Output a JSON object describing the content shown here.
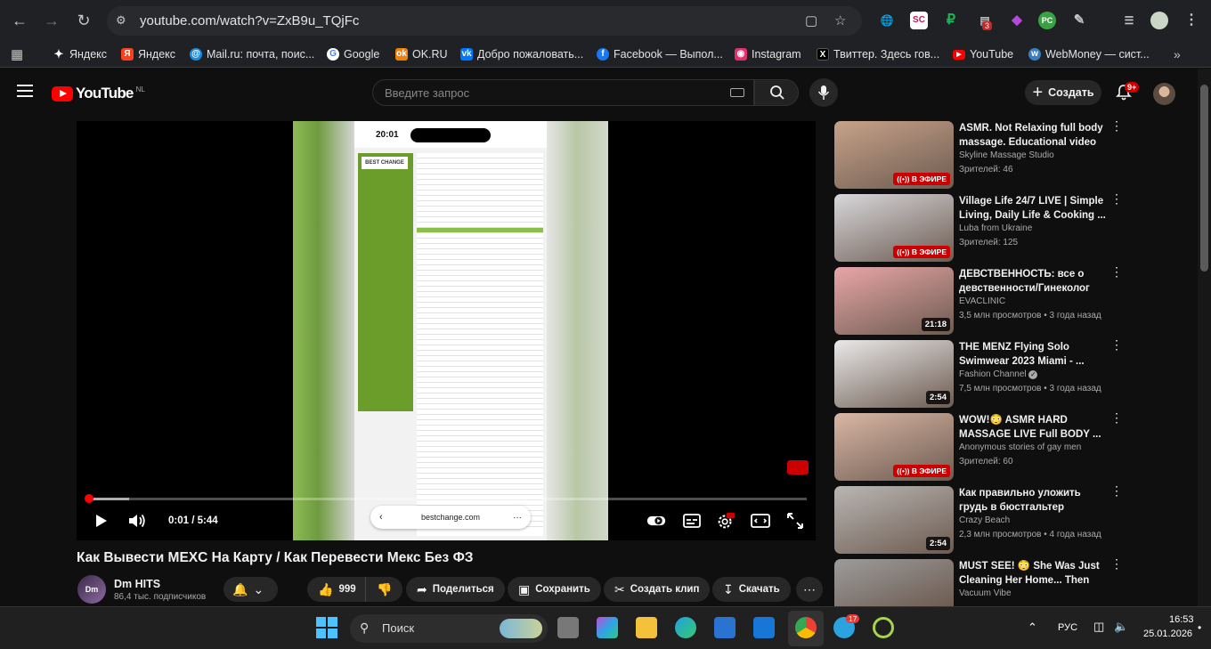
{
  "browser": {
    "url": "youtube.com/watch?v=ZxB9u_TQjFc",
    "bookmarks": [
      {
        "label": "Яндекс",
        "icon": "yandex-star-icon",
        "color": "#ffffff"
      },
      {
        "label": "Яндекс",
        "icon": "yandex-ya-icon",
        "color": "#fc3f1d"
      },
      {
        "label": "Mail.ru: почта, поис...",
        "icon": "mailru-icon",
        "color": "#168de2"
      },
      {
        "label": "Google",
        "icon": "google-icon",
        "color": "#4285f4"
      },
      {
        "label": "OK.RU",
        "icon": "ok-icon",
        "color": "#ee8208"
      },
      {
        "label": "Добро пожаловать...",
        "icon": "vk-icon",
        "color": "#0077ff"
      },
      {
        "label": "Facebook — Выпол...",
        "icon": "facebook-icon",
        "color": "#1877f2"
      },
      {
        "label": "Instagram",
        "icon": "instagram-icon",
        "color": "#e1306c"
      },
      {
        "label": "Твиттер. Здесь гов...",
        "icon": "x-icon",
        "color": "#000000"
      },
      {
        "label": "YouTube",
        "icon": "youtube-icon",
        "color": "#ff0000"
      },
      {
        "label": "WebMoney — сист...",
        "icon": "webmoney-icon",
        "color": "#3a7ec2"
      }
    ],
    "extension_badge": "3"
  },
  "youtube": {
    "logo_text": "YouTube",
    "logo_region": "NL",
    "search_placeholder": "Введите запрос",
    "create_label": "Создать",
    "notifications_badge": "9+"
  },
  "player": {
    "time": "0:01 / 5:44",
    "progress_fraction": 0.003,
    "buffered_fraction": 0.06,
    "phone_clock": "20:01",
    "phone_url": "bestchange.com",
    "site_logo": "BEST CHANGE"
  },
  "video": {
    "title": "Как Вывести MEXC На Карту / Как Перевести Мекс Без ФЗ",
    "channel": "Dm HITS",
    "channel_initials": "Dm",
    "subscribers": "86,4 тыс. подписчиков",
    "likes": "999",
    "actions": {
      "share": "Поделиться",
      "save": "Сохранить",
      "clip": "Создать клип",
      "download": "Скачать"
    }
  },
  "recommendations": [
    {
      "title": "ASMR. Not Relaxing full body massage. Educational video",
      "channel": "Skyline Massage Studio",
      "meta": "Зрителей: 46",
      "badge": "В ЭФИРЕ",
      "live": true,
      "thumb_color": "#c7a28a"
    },
    {
      "title": "Village Life 24/7 LIVE | Simple Living, Daily Life & Cooking ...",
      "channel": "Luba from Ukraine",
      "meta": "Зрителей: 125",
      "badge": "В ЭФИРЕ",
      "live": true,
      "thumb_color": "#d8d8dc"
    },
    {
      "title": "ДЕВСТВЕННОСТЬ: все о девственности/Гинеколог",
      "channel": "EVACLINIC",
      "meta": "3,5 млн просмотров • 3 года назад",
      "badge": "21:18",
      "live": false,
      "thumb_color": "#e8a6a8"
    },
    {
      "title": "THE MENZ Flying Solo Swimwear 2023 Miami - ...",
      "channel": "Fashion Channel",
      "meta": "7,5 млн просмотров • 3 года назад",
      "badge": "2:54",
      "live": false,
      "thumb_color": "#e9e9e9",
      "verified": true
    },
    {
      "title": "WOW!😳 ASMR HARD MASSAGE LIVE Full BODY ...",
      "channel": "Anonymous stories of gay men",
      "meta": "Зрителей: 60",
      "badge": "В ЭФИРЕ",
      "live": true,
      "thumb_color": "#d9b7a5"
    },
    {
      "title": "Как правильно уложить грудь в бюстгальтер",
      "channel": "Crazy Beach",
      "meta": "2,3 млн просмотров • 4 года назад",
      "badge": "2:54",
      "live": false,
      "thumb_color": "#b9b6b3"
    },
    {
      "title": "MUST SEE! 😳 She Was Just Cleaning Her Home... Then THI...",
      "channel": "Vacuum Vibe",
      "meta": "",
      "badge": "",
      "live": false,
      "thumb_color": "#9c9c9c"
    }
  ],
  "taskbar": {
    "search_label": "Поиск",
    "language": "РУС",
    "time": "16:53",
    "date": "25.01.2026",
    "telegram_badge": "17"
  }
}
